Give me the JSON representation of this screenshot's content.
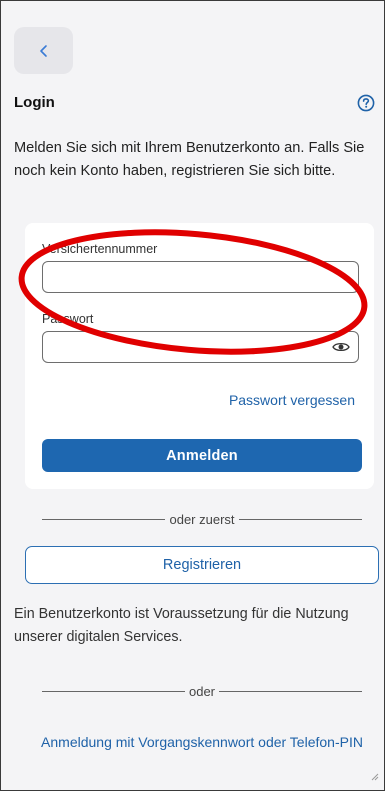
{
  "header": {
    "back_icon": "chevron-left-icon",
    "title": "Login",
    "help_icon": "question-circle-icon"
  },
  "intro_text": "Melden Sie sich mit Ihrem Benutzerkonto an. Falls Sie noch kein Konto haben, registrieren Sie sich bitte.",
  "login_form": {
    "insurance_number_label": "Versichertennummer",
    "insurance_number_value": "",
    "password_label": "Passwort",
    "password_value": "",
    "eye_icon": "eye-icon",
    "forgot_password": "Passwort vergessen",
    "submit_label": "Anmelden"
  },
  "divider_first": "oder zuerst",
  "register_label": "Registrieren",
  "account_info": "Ein Benutzerkonto ist Voraussetzung für die Nutzung unserer digitalen Services.",
  "divider_or": "oder",
  "alt_login_label": "Anmeldung mit Vorgangskennwort oder Telefon-PIN",
  "colors": {
    "primary": "#1e67b0",
    "link": "#1f62a8",
    "background": "#f4f4f6",
    "annotation": "#e00000"
  }
}
